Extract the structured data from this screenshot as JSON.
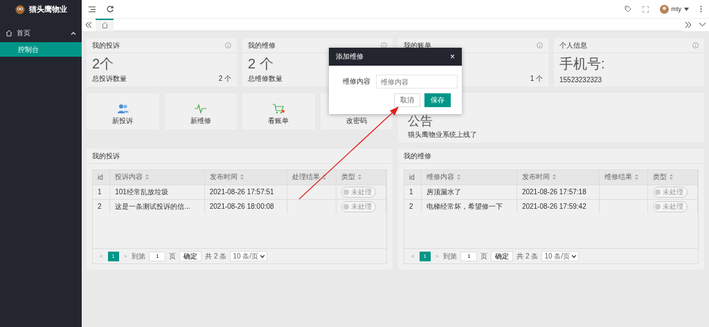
{
  "sidebar": {
    "brand": "猫头鹰物业",
    "menu": [
      {
        "label": "首页",
        "expanded": true,
        "children": [
          {
            "label": "控制台",
            "selected": true
          }
        ]
      }
    ]
  },
  "header": {
    "user": "mty"
  },
  "tabs": [
    {
      "selected": true
    }
  ],
  "stats": [
    {
      "title": "我的投诉",
      "value": "2个",
      "caption": "总投诉数量",
      "count": "2 个"
    },
    {
      "title": "我的维修",
      "value": "2 个",
      "caption": "总维修数量"
    },
    {
      "title": "我的账单",
      "count": "1 个"
    },
    {
      "title": "个人信息",
      "value": "手机号:",
      "caption": "15523232323"
    }
  ],
  "shortcuts": [
    {
      "kind": "users",
      "label": "新投诉"
    },
    {
      "kind": "pulse",
      "label": "新维修"
    },
    {
      "kind": "cart",
      "label": "看账单"
    },
    {
      "kind": "none",
      "label": "改密码"
    }
  ],
  "notice": {
    "title": "公告",
    "text": "猫头鹰物业系统上线了"
  },
  "tables": [
    {
      "title": "我的投诉",
      "columns": [
        "id",
        "投诉内容",
        "发布时间",
        "处理结果",
        "类型"
      ],
      "rows": [
        {
          "cells": [
            "1",
            "101经常乱放垃圾",
            "2021-08-26 17:57:51",
            ""
          ],
          "status": "未处理",
          "on": false
        },
        {
          "cells": [
            "2",
            "这是一条测试投诉的信...",
            "2021-08-26 18:00:08",
            ""
          ],
          "status": "未处理",
          "on": false
        }
      ],
      "pager": {
        "prev": "<",
        "pages": [
          {
            "label": "1",
            "selected": true
          }
        ],
        "next": ">",
        "goto": "到第",
        "page": "1",
        "unit": "页",
        "confirm": "确定",
        "total": "共 2 条",
        "size": "10 条/页"
      }
    },
    {
      "title": "我的维修",
      "columns": [
        "id",
        "维修内容",
        "发布时间",
        "维修结果",
        "类型"
      ],
      "rows": [
        {
          "cells": [
            "1",
            "房顶漏水了",
            "2021-08-26 17:57:18",
            ""
          ],
          "status": "未处理",
          "on": false
        },
        {
          "cells": [
            "2",
            "电梯经常坏，希望修一下",
            "2021-08-26 17:59:42",
            ""
          ],
          "status": "未处理",
          "on": false
        }
      ],
      "pager": {
        "prev": "<",
        "pages": [
          {
            "label": "1",
            "selected": true
          }
        ],
        "next": ">",
        "goto": "到第",
        "page": "1",
        "unit": "页",
        "confirm": "确定",
        "total": "共 2 条",
        "size": "10 条/页"
      }
    }
  ],
  "modal": {
    "title": "添加维修",
    "close": "×",
    "field_label": "维修内容",
    "placeholder": "维修内容",
    "buttons": [
      {
        "kind": "secondary",
        "label": "取消"
      },
      {
        "kind": "primary",
        "label": "保存"
      }
    ]
  }
}
